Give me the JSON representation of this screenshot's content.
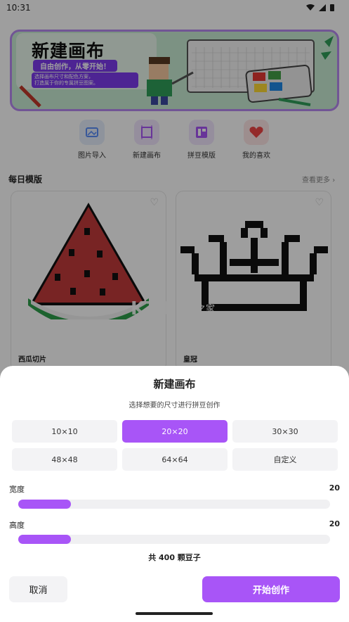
{
  "status_bar": {
    "time": "10:31"
  },
  "banner": {
    "title": "新建画布",
    "tagline": "自由创作，从零开始！",
    "desc_line1": "选择画布尺寸和配色方案，",
    "desc_line2": "打造属于你的专属拼豆图案。"
  },
  "quick_actions": [
    {
      "label": "图片导入",
      "icon": "image-import-icon",
      "color": "#5b8ff9"
    },
    {
      "label": "新建画布",
      "icon": "canvas-icon",
      "color": "#a855f7"
    },
    {
      "label": "拼豆模版",
      "icon": "template-icon",
      "color": "#a855f7"
    },
    {
      "label": "我的喜欢",
      "icon": "heart-icon",
      "color": "#ef4444"
    }
  ],
  "daily": {
    "title": "每日模版",
    "more": "查看更多",
    "cards": [
      {
        "name": "西瓜切片",
        "icon": "watermelon-pattern-icon"
      },
      {
        "name": "皇冠",
        "icon": "crown-pattern-icon"
      }
    ]
  },
  "watermark": {
    "main": "K73",
    "cn": "游戏之家",
    "domain": ".com"
  },
  "dialog": {
    "title": "新建画布",
    "subtitle": "选择想要的尺寸进行拼豆创作",
    "sizes": [
      "10×10",
      "20×20",
      "30×30",
      "48×48",
      "64×64",
      "自定义"
    ],
    "selected_size": "20×20",
    "width_label": "宽度",
    "width_value": "20",
    "width_fraction": 0.17,
    "height_label": "高度",
    "height_value": "20",
    "height_fraction": 0.17,
    "total": "共 400 颗豆子",
    "cancel": "取消",
    "start": "开始创作"
  },
  "colors": {
    "accent": "#a855f7",
    "heart": "#ef4444"
  }
}
